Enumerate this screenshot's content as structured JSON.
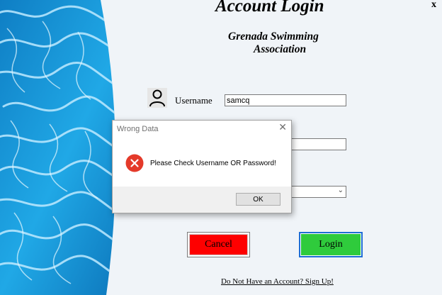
{
  "window": {
    "close_label": "x"
  },
  "header": {
    "title": "Account Login",
    "org_line1": "Grenada Swimming",
    "org_line2": "Association"
  },
  "form": {
    "username_label": "Username",
    "username_value": "samcq",
    "password_value": "",
    "role_value": ""
  },
  "buttons": {
    "cancel_label": "Cancel",
    "login_label": "Login"
  },
  "signup_link": "Do Not Have an Account? Sign Up!",
  "dialog": {
    "title": "Wrong Data",
    "message": "Please Check Username OR Password!",
    "ok_label": "OK",
    "close_glyph": "✕"
  },
  "icons": {
    "user": "user-icon",
    "error": "error-icon",
    "dropdown": "chevron-down-icon"
  },
  "colors": {
    "cancel_bg": "#fe0000",
    "login_bg": "#2fcb3c",
    "login_border": "#1f6ed4",
    "error_red": "#e43a2a",
    "pool_blue": "#1a9fe0"
  }
}
